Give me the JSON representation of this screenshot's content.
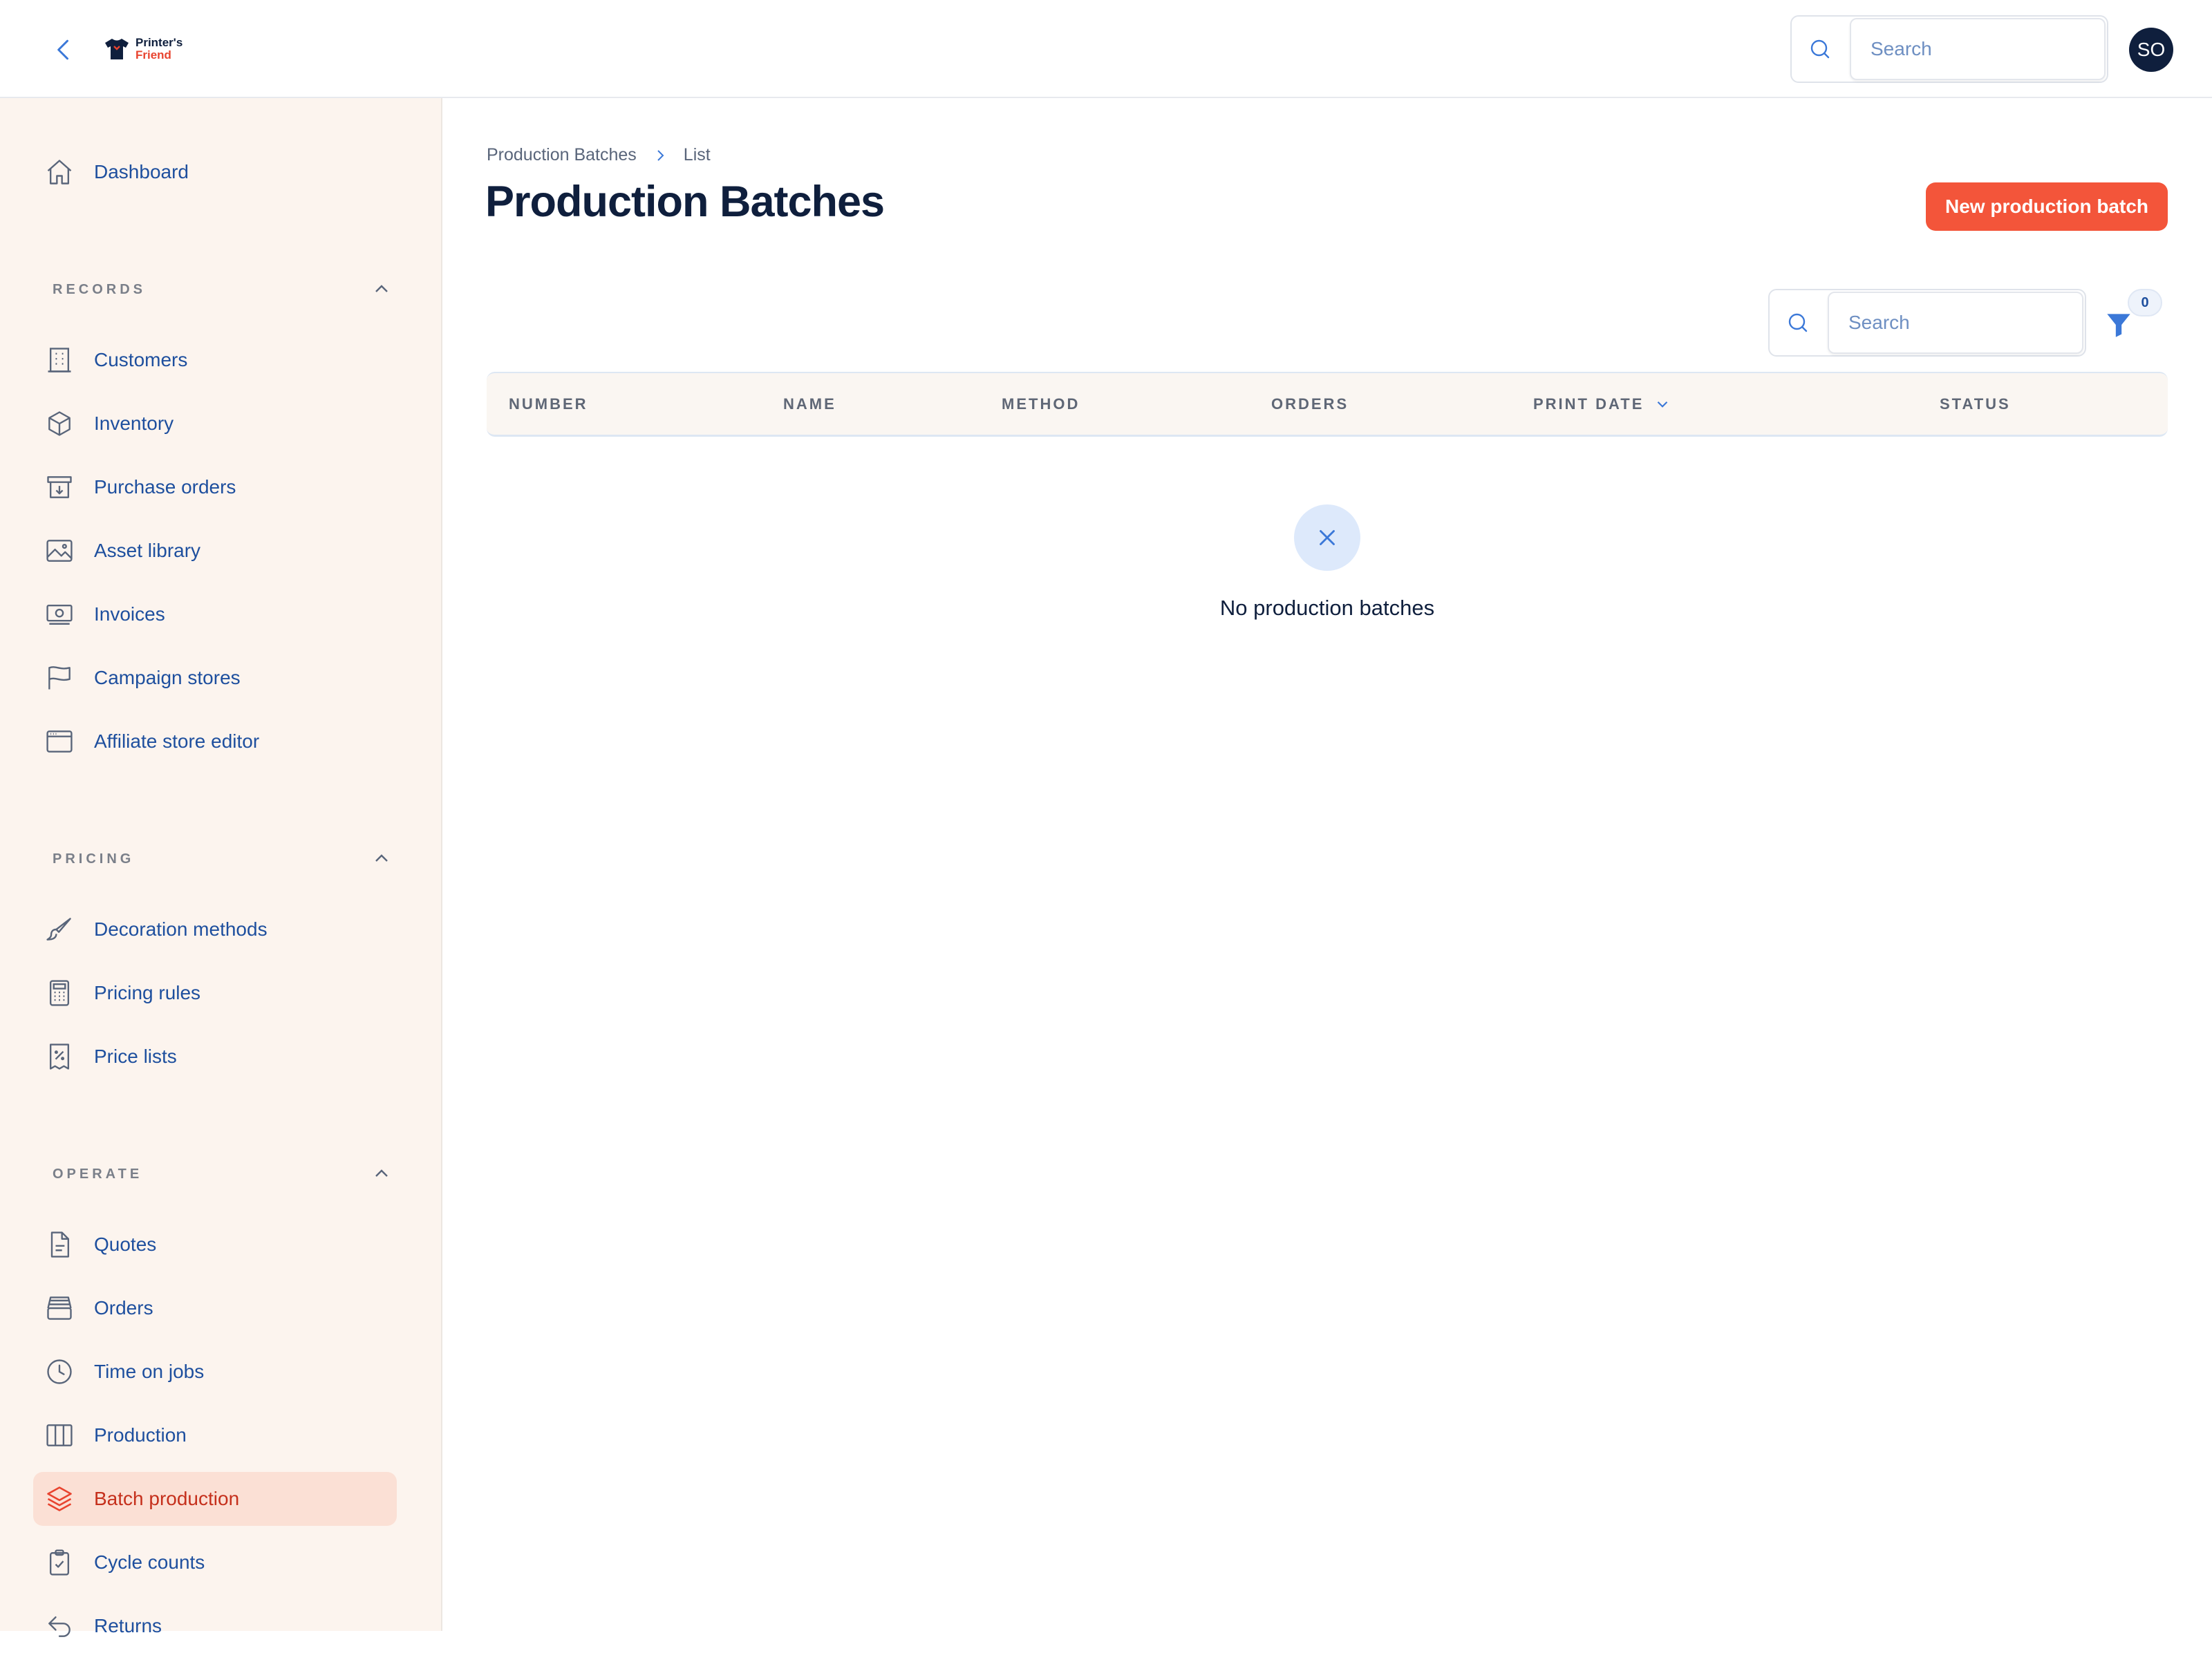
{
  "app": {
    "logo_line1": "Printer's",
    "logo_line2": "Friend",
    "search_placeholder": "Search",
    "user_initials": "SO"
  },
  "sidebar": {
    "dashboard": {
      "label": "Dashboard",
      "icon": "home-icon"
    },
    "sections": [
      {
        "title": "RECORDS",
        "items": [
          {
            "label": "Customers",
            "icon": "building-icon"
          },
          {
            "label": "Inventory",
            "icon": "cube-icon"
          },
          {
            "label": "Purchase orders",
            "icon": "archive-download-icon"
          },
          {
            "label": "Asset library",
            "icon": "image-icon"
          },
          {
            "label": "Invoices",
            "icon": "banknote-icon"
          },
          {
            "label": "Campaign stores",
            "icon": "flag-icon"
          },
          {
            "label": "Affiliate store editor",
            "icon": "browser-window-icon"
          }
        ]
      },
      {
        "title": "PRICING",
        "items": [
          {
            "label": "Decoration methods",
            "icon": "paintbrush-icon"
          },
          {
            "label": "Pricing rules",
            "icon": "calculator-icon"
          },
          {
            "label": "Price lists",
            "icon": "receipt-percent-icon"
          }
        ]
      },
      {
        "title": "OPERATE",
        "items": [
          {
            "label": "Quotes",
            "icon": "document-icon"
          },
          {
            "label": "Orders",
            "icon": "inbox-stack-icon"
          },
          {
            "label": "Time on jobs",
            "icon": "clock-icon"
          },
          {
            "label": "Production",
            "icon": "columns-icon"
          },
          {
            "label": "Batch production",
            "icon": "layers-icon",
            "active": true
          },
          {
            "label": "Cycle counts",
            "icon": "clipboard-check-icon"
          },
          {
            "label": "Returns",
            "icon": "return-arrow-icon"
          }
        ]
      }
    ]
  },
  "breadcrumb": {
    "parent": "Production Batches",
    "current": "List"
  },
  "page": {
    "title": "Production Batches",
    "new_button": "New production batch",
    "table_search_placeholder": "Search",
    "filter_count": "0"
  },
  "table": {
    "columns": [
      "NUMBER",
      "NAME",
      "METHOD",
      "ORDERS",
      "PRINT DATE",
      "STATUS"
    ],
    "sorted_column": "PRINT DATE",
    "rows": [],
    "empty_message": "No production batches"
  },
  "colors": {
    "accent": "#f3553a",
    "link": "#1e4f9e",
    "sidebar_bg": "#fcf4ee",
    "active_bg": "#fbe0d5",
    "active_text": "#c5301c"
  }
}
